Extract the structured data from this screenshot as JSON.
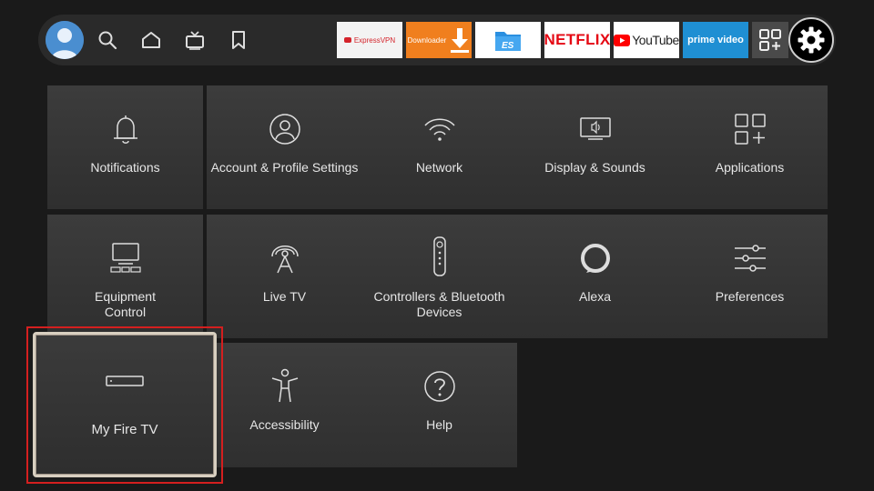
{
  "topbar": {
    "nav_icons": [
      "search-icon",
      "home-icon",
      "live-tv-icon",
      "bookmark-icon"
    ],
    "apps": {
      "expressvpn": "ExpressVPN",
      "downloader": "Downloader",
      "es": "ES",
      "netflix": "NETFLIX",
      "youtube": "YouTube",
      "prime": "prime video"
    }
  },
  "settings": {
    "notifications": "Notifications",
    "account_profile": "Account & Profile Settings",
    "network": "Network",
    "display_sounds": "Display & Sounds",
    "applications": "Applications",
    "equipment_control": "Equipment Control",
    "live_tv": "Live TV",
    "controllers_bluetooth": "Controllers & Bluetooth Devices",
    "alexa": "Alexa",
    "preferences": "Preferences",
    "my_fire_tv": "My Fire TV",
    "accessibility": "Accessibility",
    "help": "Help"
  },
  "colors": {
    "background": "#1a1a1a",
    "card": "#353535",
    "focus_highlight": "#d41f1f",
    "avatar": "#3f7fc0"
  }
}
